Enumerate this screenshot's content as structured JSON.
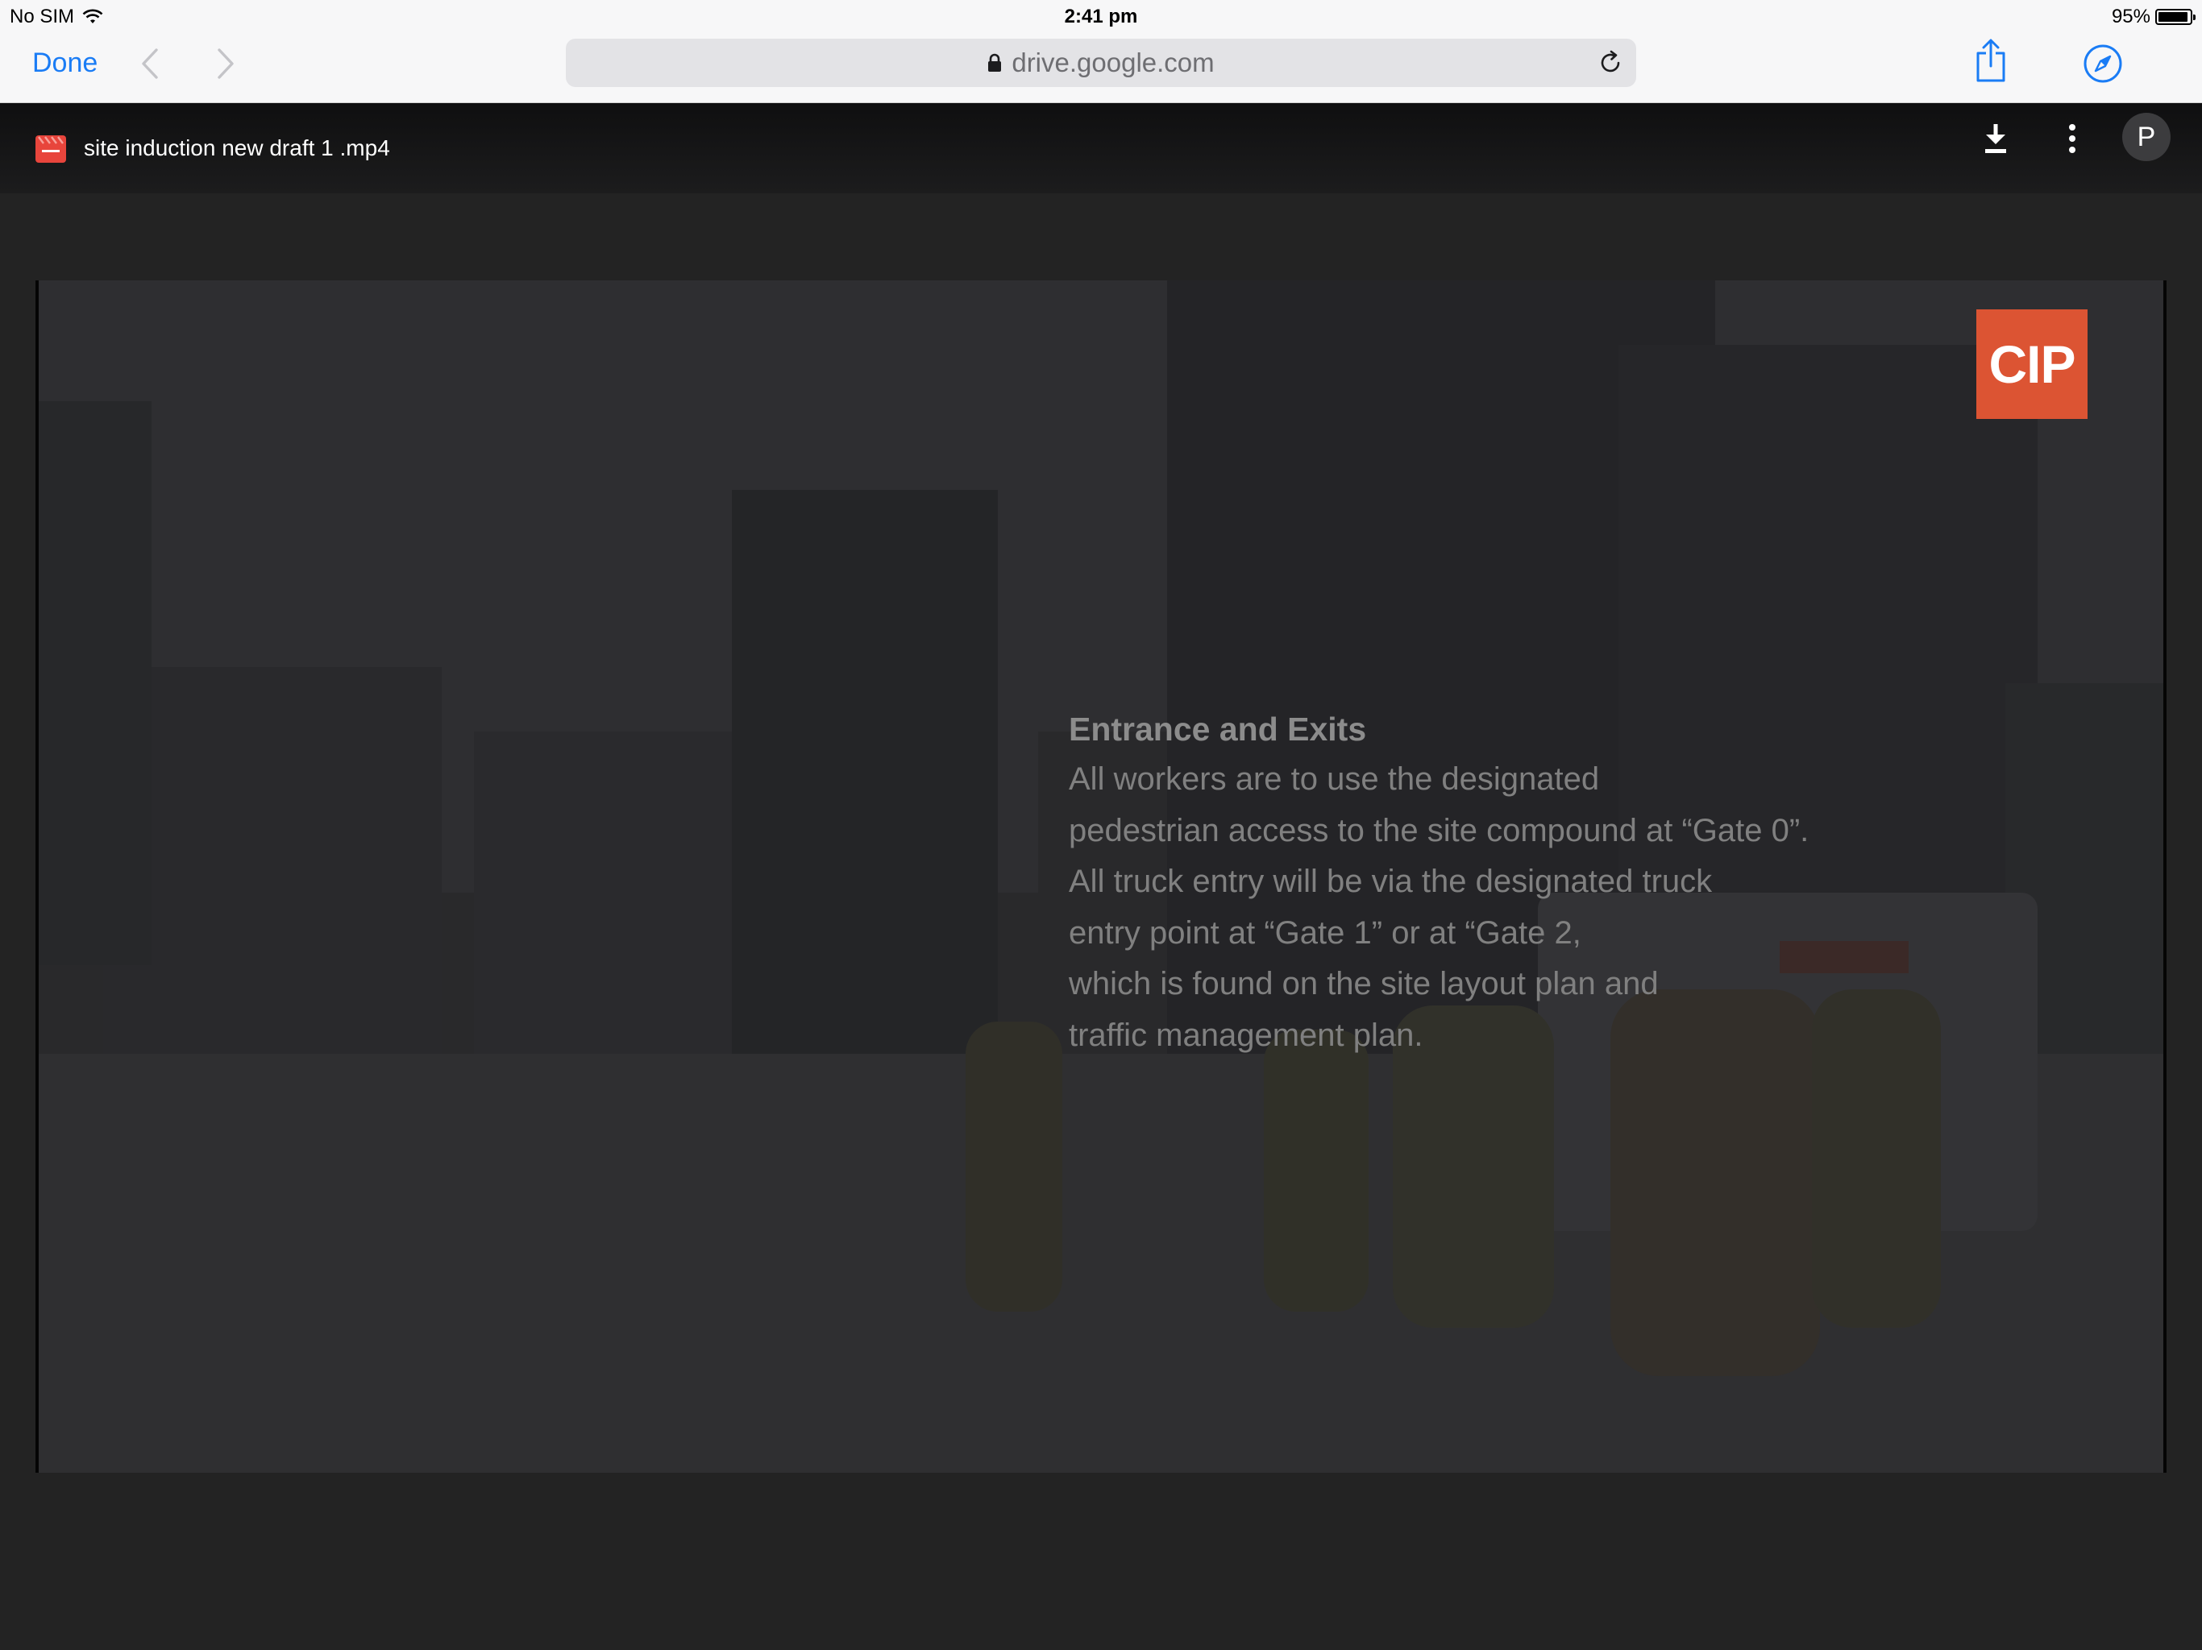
{
  "status_bar": {
    "carrier": "No SIM",
    "time": "2:41 pm",
    "battery": "95%",
    "battery_level": 0.95
  },
  "safari": {
    "done_label": "Done",
    "url": "drive.google.com",
    "accent_color": "#1a7cf5"
  },
  "drive_viewer": {
    "file_name": "site induction new draft 1 .mp4",
    "file_icon": "video-file-icon",
    "avatar_letter": "P",
    "icons": [
      "download-icon",
      "more-vert-icon"
    ]
  },
  "video": {
    "logo_text": "CIP",
    "logo_color": "#dc5433",
    "slide_heading": "Entrance and Exits",
    "slide_lines": [
      "All workers are to use the designated",
      "pedestrian access to the site compound at “Gate 0”.",
      "All truck entry will be via the designated truck",
      "entry point at “Gate 1” or at “Gate 2,",
      "which is found on the site layout plan and",
      "traffic management plan."
    ]
  }
}
